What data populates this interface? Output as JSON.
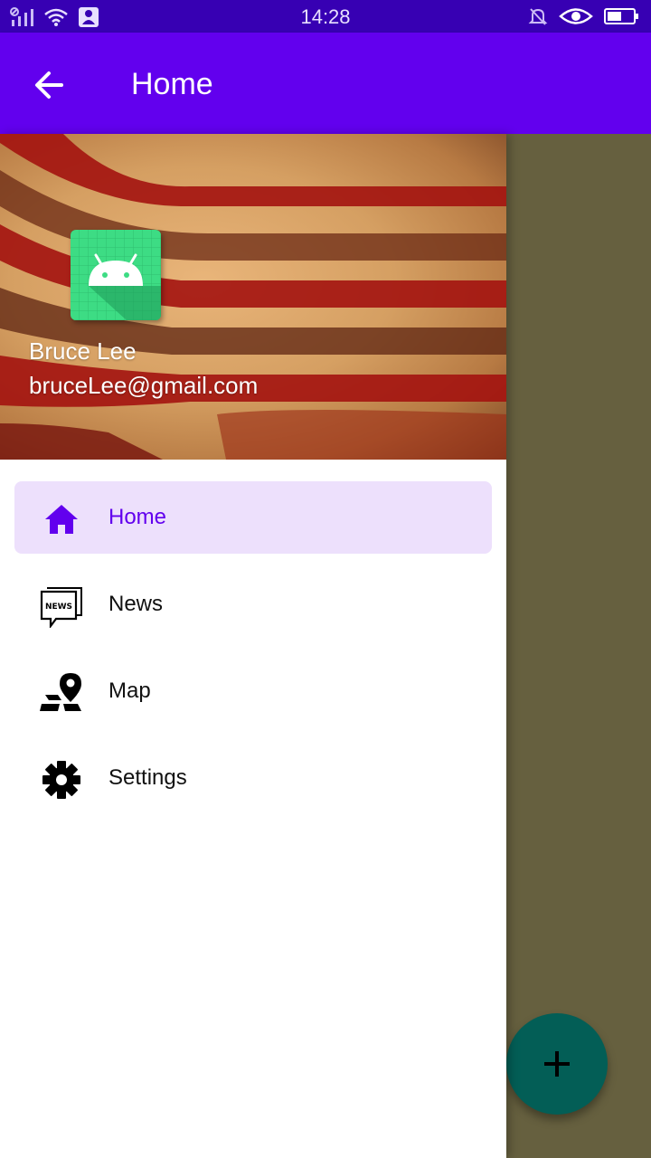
{
  "status_bar": {
    "time": "14:28",
    "icons_left": [
      "signal-icon",
      "wifi-icon",
      "notification-app-icon"
    ],
    "icons_right": [
      "bell-off-icon",
      "eye-icon",
      "battery-icon"
    ]
  },
  "app_bar": {
    "title": "Home",
    "background": "#6200ee",
    "status_background": "#3700b3"
  },
  "drawer": {
    "header": {
      "user_name": "Bruce Lee",
      "user_email": "bruceLee@gmail.com",
      "avatar_icon": "android-icon"
    },
    "items": [
      {
        "label": "Home",
        "icon": "home-icon",
        "selected": true
      },
      {
        "label": "News",
        "icon": "news-icon",
        "selected": false
      },
      {
        "label": "Map",
        "icon": "map-pin-icon",
        "selected": false
      },
      {
        "label": "Settings",
        "icon": "gear-icon",
        "selected": false
      }
    ],
    "selected_background": "#ede0fc",
    "accent": "#6200ee"
  },
  "fab": {
    "icon": "plus-icon",
    "color": "#035e56"
  }
}
